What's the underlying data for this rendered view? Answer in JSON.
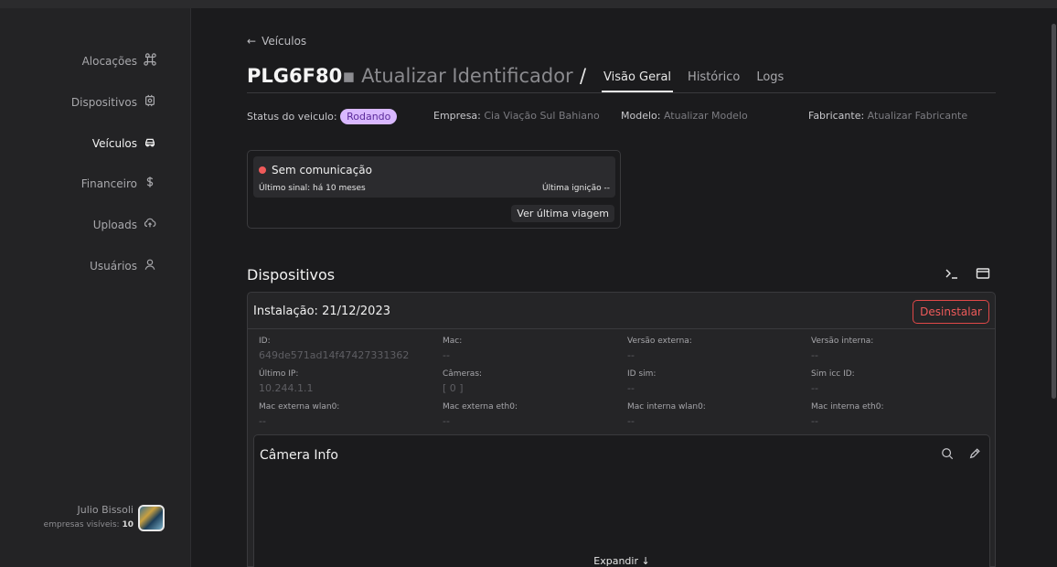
{
  "sidebar": {
    "items": [
      {
        "label": "Alocações",
        "icon": "command-icon"
      },
      {
        "label": "Dispositivos",
        "icon": "device-icon"
      },
      {
        "label": "Veículos",
        "icon": "car-icon",
        "active": true
      },
      {
        "label": "Financeiro",
        "icon": "dollar-icon"
      },
      {
        "label": "Uploads",
        "icon": "cloud-upload-icon"
      },
      {
        "label": "Usuários",
        "icon": "user-icon"
      }
    ],
    "user": {
      "name": "Julio Bissoli",
      "visible_label": "empresas visíveis:",
      "visible_count": "10"
    }
  },
  "header": {
    "back_label": "Veículos",
    "plate": "PLG6F80",
    "separator_dot": "▪",
    "identifier": "Atualizar Identificador",
    "slash": "/",
    "tabs": [
      {
        "label": "Visão Geral",
        "active": true
      },
      {
        "label": "Histórico"
      },
      {
        "label": "Logs"
      }
    ]
  },
  "meta": {
    "status_label": "Status do veiculo:",
    "status_value": "Rodando",
    "company_label": "Empresa:",
    "company_value": "Cia Viação Sul Bahiano",
    "model_label": "Modelo:",
    "model_value": "Atualizar Modelo",
    "maker_label": "Fabricante:",
    "maker_value": "Atualizar Fabricante"
  },
  "status_card": {
    "title": "Sem comunicação",
    "last_signal": "Último sinal: há 10 meses",
    "last_ignition": "Última ignição --",
    "trip_button": "Ver última viagem"
  },
  "devices": {
    "title": "Dispositivos",
    "install_date": "Instalação: 21/12/2023",
    "uninstall_label": "Desinstalar",
    "fields": [
      {
        "label": "ID:",
        "value": "649de571ad14f47427331362"
      },
      {
        "label": "Mac:",
        "value": "--"
      },
      {
        "label": "Versão externa:",
        "value": "--"
      },
      {
        "label": "Versão interna:",
        "value": "--"
      },
      {
        "label": "Último IP:",
        "value": "10.244.1.1"
      },
      {
        "label": "Câmeras:",
        "value": "[ 0 ]"
      },
      {
        "label": "ID sim:",
        "value": "--"
      },
      {
        "label": "Sim icc ID:",
        "value": "--"
      },
      {
        "label": "Mac externa wlan0:",
        "value": "--"
      },
      {
        "label": "Mac externa eth0:",
        "value": "--"
      },
      {
        "label": "Mac interna wlan0:",
        "value": "--"
      },
      {
        "label": "Mac interna eth0:",
        "value": "--"
      }
    ],
    "camera": {
      "title": "Câmera Info",
      "expand_label": "Expandir ↓"
    }
  },
  "colors": {
    "badge_bg": "#d9b8ff",
    "badge_text": "#5b2a9a",
    "danger": "#ef5a5a"
  }
}
